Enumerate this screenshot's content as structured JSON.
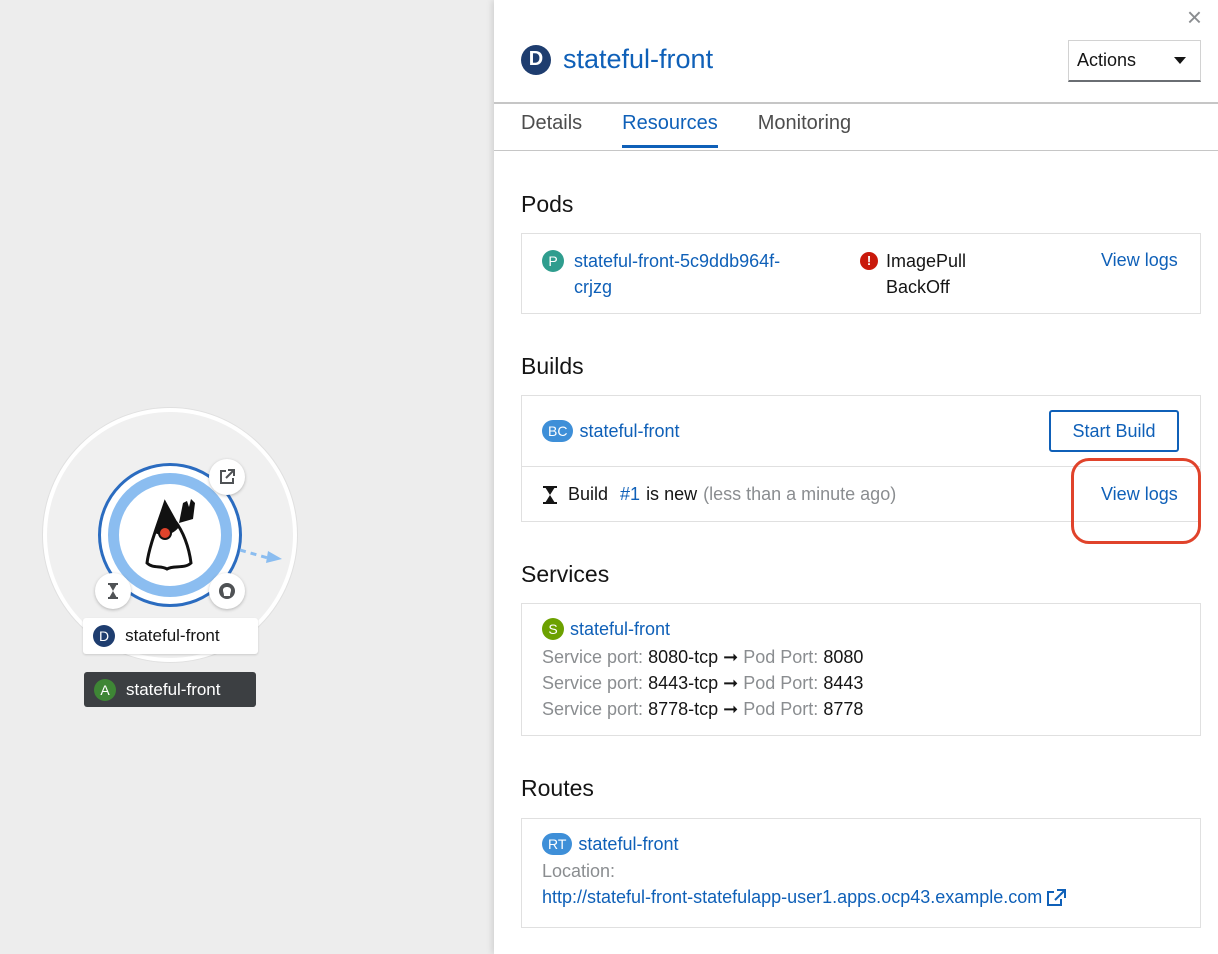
{
  "topology": {
    "node_badge": "D",
    "node_name": "stateful-front",
    "app_badge": "A",
    "app_name": "stateful-front",
    "icons": [
      "duke-java-icon",
      "external-link-icon",
      "hourglass-icon",
      "github-icon",
      "connector-arrow-icon"
    ]
  },
  "panel": {
    "badge": "D",
    "title": "stateful-front",
    "actions_label": "Actions",
    "close_label": "×",
    "tabs": [
      {
        "label": "Details"
      },
      {
        "label": "Resources"
      },
      {
        "label": "Monitoring"
      }
    ],
    "active_tab": "Resources"
  },
  "pods": {
    "title": "Pods",
    "badge": "P",
    "name_line1": "stateful-front-5c9ddb964f-",
    "name_line2": "crjzg",
    "status_line1": "ImagePull",
    "status_line2": "BackOff",
    "status_icon": "!",
    "view_logs": "View logs"
  },
  "builds": {
    "title": "Builds",
    "badge": "BC",
    "config_name": "stateful-front",
    "start_build": "Start Build",
    "build_label": "Build",
    "build_number": "#1",
    "build_state": "is new",
    "build_time": "(less than a minute ago)",
    "view_logs": "View logs"
  },
  "services": {
    "title": "Services",
    "badge": "S",
    "name": "stateful-front",
    "service_port_label": "Service port:",
    "pod_port_label": "Pod Port:",
    "arrow": "➞",
    "ports": [
      {
        "service": "8080-tcp",
        "pod": "8080"
      },
      {
        "service": "8443-tcp",
        "pod": "8443"
      },
      {
        "service": "8778-tcp",
        "pod": "8778"
      }
    ]
  },
  "routes": {
    "title": "Routes",
    "badge": "RT",
    "name": "stateful-front",
    "location_label": "Location:",
    "url": "http://stateful-front-statefulapp-user1.apps.ocp43.example.com"
  },
  "colors": {
    "link": "#0f60b8",
    "error": "#c9190b",
    "highlight": "#e0432b"
  }
}
